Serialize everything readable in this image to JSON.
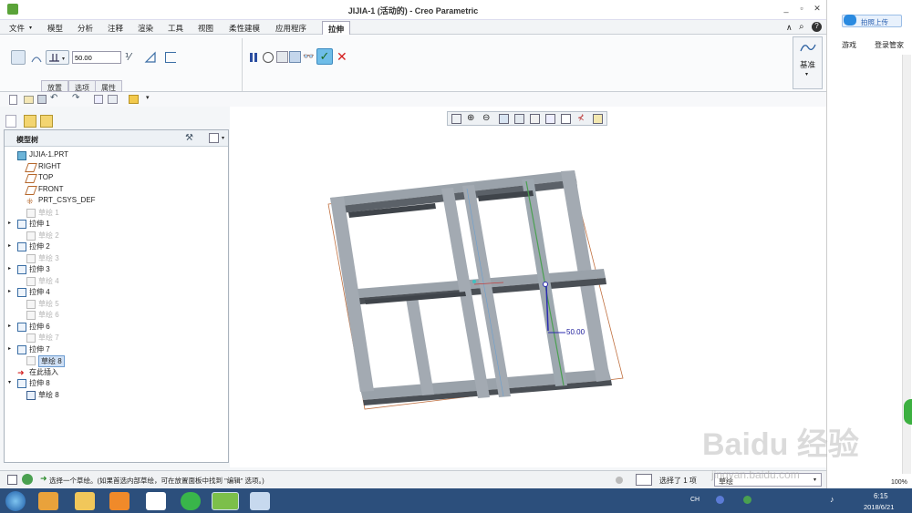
{
  "window": {
    "title": "JIJIA-1 (活动的) - Creo Parametric"
  },
  "menu": {
    "items": [
      "文件",
      "模型",
      "分析",
      "注释",
      "渲染",
      "工具",
      "视图",
      "柔性建模",
      "应用程序"
    ],
    "active_tab": "拉伸"
  },
  "ribbon": {
    "depth_value": "50.00",
    "subtabs": [
      "放置",
      "选项",
      "属性"
    ],
    "datum_label": "基准"
  },
  "tree": {
    "header": "模型树",
    "items": [
      {
        "label": "JIJIA-1.PRT",
        "dim": false
      },
      {
        "label": "RIGHT",
        "dim": false
      },
      {
        "label": "TOP",
        "dim": false
      },
      {
        "label": "FRONT",
        "dim": false
      },
      {
        "label": "PRT_CSYS_DEF",
        "dim": false
      },
      {
        "label": "草绘 1",
        "dim": true
      },
      {
        "label": "拉伸 1",
        "dim": false
      },
      {
        "label": "草绘 2",
        "dim": true
      },
      {
        "label": "拉伸 2",
        "dim": false
      },
      {
        "label": "草绘 3",
        "dim": true
      },
      {
        "label": "拉伸 3",
        "dim": false
      },
      {
        "label": "草绘 4",
        "dim": true
      },
      {
        "label": "拉伸 4",
        "dim": false
      },
      {
        "label": "草绘 5",
        "dim": true
      },
      {
        "label": "草绘 6",
        "dim": true
      },
      {
        "label": "拉伸 6",
        "dim": false
      },
      {
        "label": "草绘 7",
        "dim": true
      },
      {
        "label": "拉伸 7",
        "dim": false
      },
      {
        "label": "草绘 8",
        "dim": false
      },
      {
        "label": "在此插入",
        "dim": false
      },
      {
        "label": "拉伸 8",
        "dim": false
      },
      {
        "label": "草绘 8",
        "dim": false
      }
    ]
  },
  "viewport": {
    "dimension_label": "50.00"
  },
  "status": {
    "message": "选择一个草绘。(如果首选内部草绘，可在放置面板中找到 \"编辑\" 选项。)",
    "selected": "选择了 1 项",
    "filter": "草绘"
  },
  "browser_side": {
    "upload_label": "拍照上传",
    "games_label": "游戏",
    "login_label": "登录管家",
    "zoom_label": "100%"
  },
  "taskbar": {
    "time": "6:15",
    "date": "2018/6/21",
    "lang": "CH"
  },
  "watermark": {
    "text": "Baidu 经验",
    "url": "jingyan.baidu.com"
  }
}
